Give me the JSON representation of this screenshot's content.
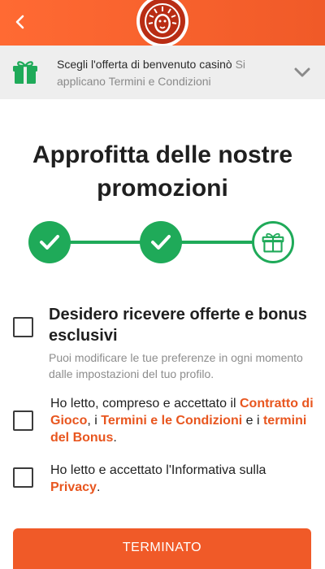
{
  "header": {
    "logo_icon": "lion-head-logo-icon",
    "brand_color": "#f05a28"
  },
  "offer": {
    "text": "Scegli l'offerta di benvenuto casinò",
    "muted": "Si applicano Termini e Condizioni",
    "icon": "gift-icon",
    "expand_icon": "chevron-down-icon"
  },
  "title": "Approfitta delle nostre promozioni",
  "stepper": {
    "steps": [
      {
        "status": "completed",
        "icon": "check-icon"
      },
      {
        "status": "completed",
        "icon": "check-icon"
      },
      {
        "status": "current",
        "icon": "gift-icon"
      }
    ],
    "accent": "#1faa59"
  },
  "consents": {
    "offers": {
      "label": "Desidero ricevere offerte e bonus esclusivi",
      "note": "Puoi modificare le tue preferenze in ogni momento dalle impostazioni del tuo profilo.",
      "checked": false
    },
    "terms": {
      "t1": "Ho letto, compreso e accettato il ",
      "l1": "Contratto di Gioco",
      "t2": ", i ",
      "l2": "Termini e le Condizioni",
      "t3": " e i ",
      "l3": "termini del Bonus",
      "t4": ".",
      "checked": false
    },
    "privacy": {
      "t1": "Ho letto e accettato l'Informativa sulla ",
      "l1": "Privacy",
      "t2": ".",
      "checked": false
    }
  },
  "cta": {
    "label": "TERMINATO"
  }
}
